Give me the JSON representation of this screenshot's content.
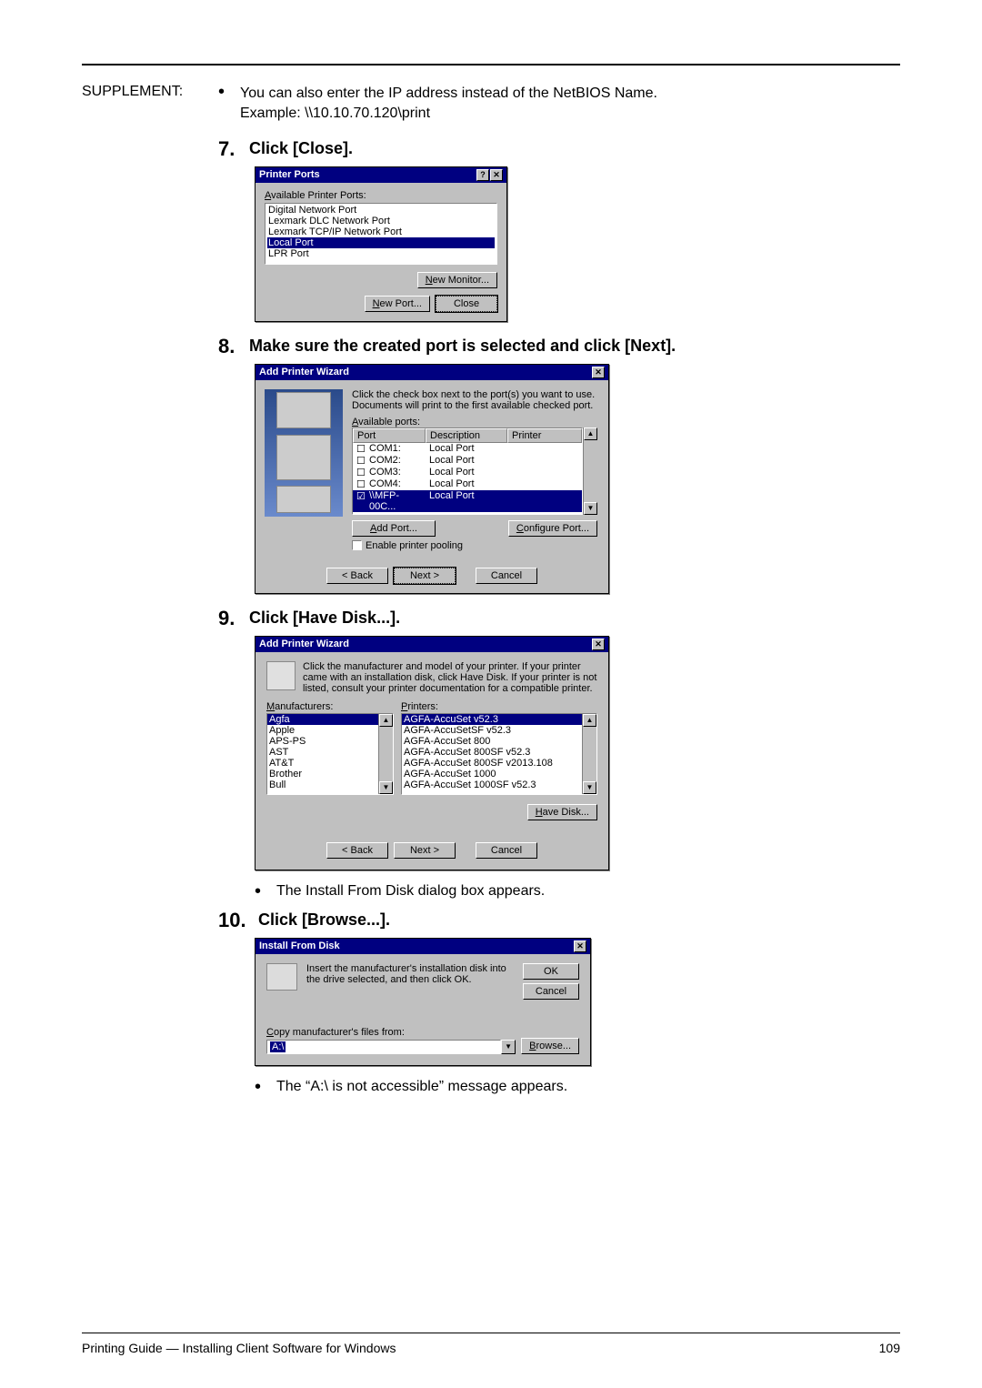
{
  "supplement": {
    "label": "SUPPLEMENT:",
    "line1": "You can also enter the IP address instead of the NetBIOS Name.",
    "line2": "Example: \\\\10.10.70.120\\print"
  },
  "steps": {
    "s7": {
      "num": "7.",
      "text": "Click [Close]."
    },
    "s8": {
      "num": "8.",
      "text": "Make sure the created port is selected and click [Next]."
    },
    "s9": {
      "num": "9.",
      "text": "Click [Have Disk...]."
    },
    "s10": {
      "num": "10.",
      "text": "Click [Browse...]."
    }
  },
  "bullets": {
    "b1": "The Install From Disk dialog box appears.",
    "b2": "The “A:\\ is not accessible” message appears."
  },
  "dlg_ports": {
    "title": "Printer Ports",
    "label": "Available Printer Ports:",
    "items": [
      "Digital Network Port",
      "Lexmark DLC Network Port",
      "Lexmark TCP/IP Network Port",
      "Local Port",
      "LPR Port"
    ],
    "selected_index": 3,
    "btn_new_monitor": "New Monitor...",
    "btn_new_port": "New Port...",
    "btn_close": "Close"
  },
  "dlg_wiz_ports": {
    "title": "Add Printer Wizard",
    "instr": "Click the check box next to the port(s) you want to use. Documents will print to the first available checked port.",
    "label": "Available ports:",
    "headers": {
      "port": "Port",
      "desc": "Description",
      "printer": "Printer"
    },
    "rows": [
      {
        "checked": false,
        "port": "COM1:",
        "desc": "Local Port",
        "printer": ""
      },
      {
        "checked": false,
        "port": "COM2:",
        "desc": "Local Port",
        "printer": ""
      },
      {
        "checked": false,
        "port": "COM3:",
        "desc": "Local Port",
        "printer": ""
      },
      {
        "checked": false,
        "port": "COM4:",
        "desc": "Local Port",
        "printer": ""
      },
      {
        "checked": true,
        "port": "\\\\MFP-00C...",
        "desc": "Local Port",
        "printer": ""
      }
    ],
    "btn_add_port": "Add Port...",
    "btn_configure": "Configure Port...",
    "chk_pooling": "Enable printer pooling",
    "btn_back": "< Back",
    "btn_next": "Next >",
    "btn_cancel": "Cancel"
  },
  "dlg_have_disk": {
    "title": "Add Printer Wizard",
    "instr": "Click the manufacturer and model of your printer. If your printer came with an installation disk, click Have Disk. If your printer is not listed, consult your printer documentation for a compatible printer.",
    "label_manu": "Manufacturers:",
    "label_prn": "Printers:",
    "manufacturers": [
      "Agfa",
      "Apple",
      "APS-PS",
      "AST",
      "AT&T",
      "Brother",
      "Bull"
    ],
    "manu_selected": 0,
    "printers": [
      "AGFA-AccuSet v52.3",
      "AGFA-AccuSetSF v52.3",
      "AGFA-AccuSet 800",
      "AGFA-AccuSet 800SF v52.3",
      "AGFA-AccuSet 800SF v2013.108",
      "AGFA-AccuSet 1000",
      "AGFA-AccuSet 1000SF v52.3"
    ],
    "prn_selected": 0,
    "btn_have": "Have Disk...",
    "btn_back": "< Back",
    "btn_next": "Next >",
    "btn_cancel": "Cancel"
  },
  "dlg_ifd": {
    "title": "Install From Disk",
    "instr": "Insert the manufacturer's installation disk into the drive selected, and then click OK.",
    "btn_ok": "OK",
    "btn_cancel": "Cancel",
    "label_copy": "Copy manufacturer's files from:",
    "combo_value": "A:\\",
    "btn_browse": "Browse..."
  },
  "footer": {
    "left": "Printing Guide — Installing Client Software for Windows",
    "right": "109"
  }
}
